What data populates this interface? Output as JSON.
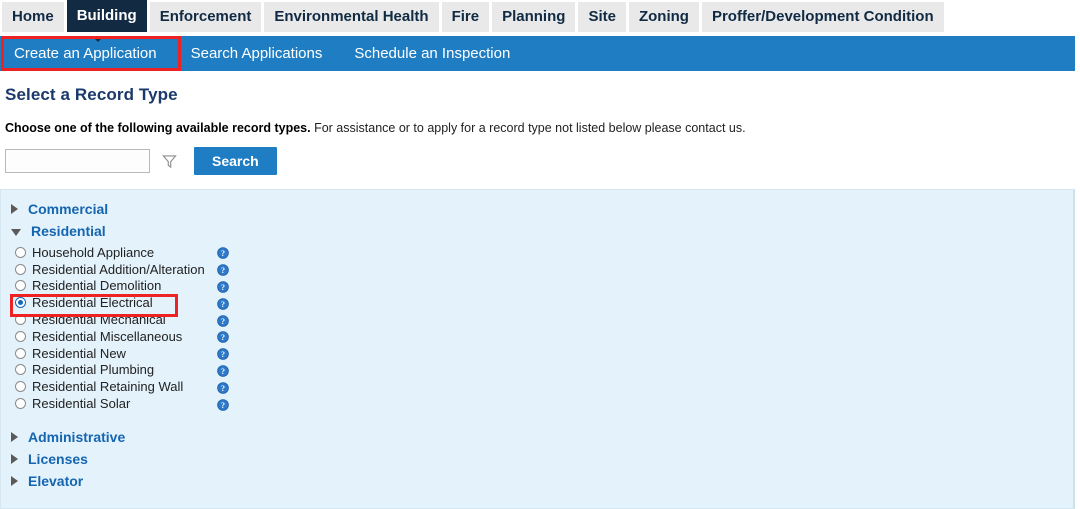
{
  "modules": {
    "tabs": [
      {
        "label": "Home",
        "active": false
      },
      {
        "label": "Building",
        "active": true
      },
      {
        "label": "Enforcement",
        "active": false
      },
      {
        "label": "Environmental Health",
        "active": false
      },
      {
        "label": "Fire",
        "active": false
      },
      {
        "label": "Planning",
        "active": false
      },
      {
        "label": "Site",
        "active": false
      },
      {
        "label": "Zoning",
        "active": false
      },
      {
        "label": "Proffer/Development Condition",
        "active": false
      }
    ]
  },
  "subnav": {
    "items": [
      {
        "label": "Create an Application",
        "highlighted": true
      },
      {
        "label": "Search Applications",
        "highlighted": false
      },
      {
        "label": "Schedule an Inspection",
        "highlighted": false
      }
    ]
  },
  "page": {
    "title": "Select a Record Type",
    "instructions_bold": "Choose one of the following available record types.",
    "instructions_rest": " For assistance or to apply for a record type not listed below please contact us."
  },
  "search": {
    "value": "",
    "placeholder": "",
    "filter_icon": "funnel-icon",
    "button_label": "Search"
  },
  "record_types": {
    "help_icon": "help-question-icon",
    "groups": [
      {
        "label": "Commercial",
        "expanded": false,
        "items": []
      },
      {
        "label": "Residential",
        "expanded": true,
        "items": [
          {
            "label": "Household Appliance",
            "selected": false
          },
          {
            "label": "Residential Addition/Alteration",
            "selected": false
          },
          {
            "label": "Residential Demolition",
            "selected": false
          },
          {
            "label": "Residential Electrical",
            "selected": true
          },
          {
            "label": "Residential Mechanical",
            "selected": false
          },
          {
            "label": "Residential Miscellaneous",
            "selected": false
          },
          {
            "label": "Residential New",
            "selected": false
          },
          {
            "label": "Residential Plumbing",
            "selected": false
          },
          {
            "label": "Residential Retaining Wall",
            "selected": false
          },
          {
            "label": "Residential Solar",
            "selected": false
          }
        ]
      },
      {
        "label": "Administrative",
        "expanded": false,
        "items": []
      },
      {
        "label": "Licenses",
        "expanded": false,
        "items": []
      },
      {
        "label": "Elevator",
        "expanded": false,
        "items": []
      }
    ]
  },
  "annotations": {
    "highlight_color": "#ee2222",
    "boxes": [
      {
        "name": "create-an-application-highlight"
      },
      {
        "name": "residential-electrical-highlight"
      }
    ]
  },
  "colors": {
    "active_tab": "#122b42",
    "subnav_blue": "#1f7dc4",
    "panel_blue": "#e3f2fb",
    "link_blue": "#1565b0",
    "title_blue": "#1b3a6b"
  }
}
